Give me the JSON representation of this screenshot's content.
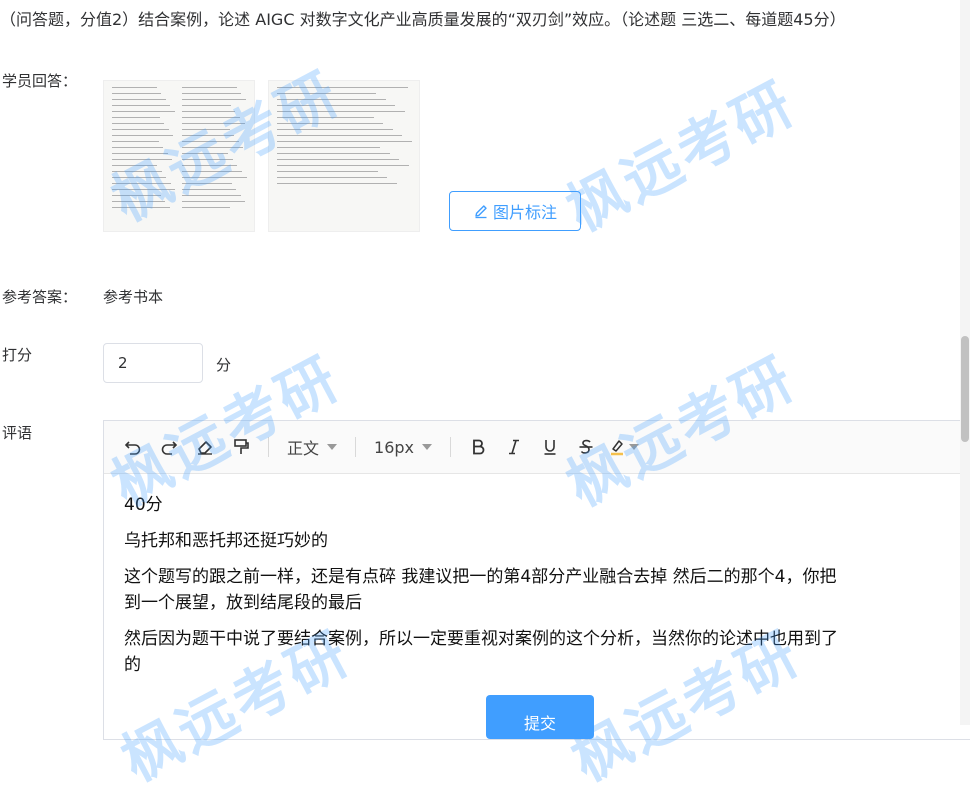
{
  "question": {
    "text": "（问答题，分值2）结合案例，论述 AIGC 对数字文化产业高质量发展的“双刃剑”效应。（论述题 三选二、每道题45分）"
  },
  "student_answer": {
    "label": "学员回答：",
    "annotate_button": "图片标注"
  },
  "reference": {
    "label": "参考答案：",
    "value": "参考书本"
  },
  "score": {
    "label": "打分",
    "value": "2",
    "unit": "分"
  },
  "comment": {
    "label": "评语",
    "toolbar": {
      "paragraph_style": "正文",
      "font_size": "16px"
    },
    "content": [
      "40分",
      "乌托邦和恶托邦还挺巧妙的",
      "这个题写的跟之前一样，还是有点碎 我建议把一的第4部分产业融合去掉 然后二的那个4，你把",
      "到一个展望，放到结尾段的最后",
      "然后因为题干中说了要结合案例，所以一定要重视对案例的这个分析，当然你的论述中也用到了",
      "的"
    ]
  },
  "submit_button": "提交",
  "watermark": "枫远考研",
  "colors": {
    "primary": "#409eff",
    "watermark": "rgba(64,158,255,0.28)"
  }
}
